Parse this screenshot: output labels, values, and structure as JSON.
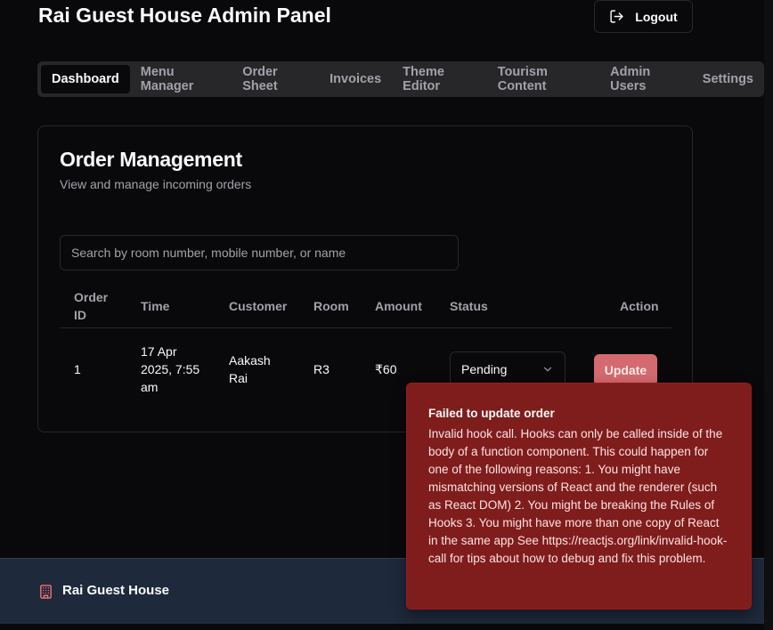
{
  "header": {
    "title": "Rai Guest House Admin Panel",
    "logout_label": "Logout"
  },
  "nav": {
    "tabs": [
      {
        "label": "Dashboard",
        "active": true
      },
      {
        "label": "Menu Manager",
        "active": false
      },
      {
        "label": "Order Sheet",
        "active": false
      },
      {
        "label": "Invoices",
        "active": false
      },
      {
        "label": "Theme Editor",
        "active": false
      },
      {
        "label": "Tourism Content",
        "active": false
      },
      {
        "label": "Admin Users",
        "active": false
      },
      {
        "label": "Settings",
        "active": false
      }
    ]
  },
  "card": {
    "title": "Order Management",
    "subtitle": "View and manage incoming orders",
    "search_placeholder": "Search by room number, mobile number, or name"
  },
  "table": {
    "headers": {
      "order_id": "Order ID",
      "time": "Time",
      "customer": "Customer",
      "room": "Room",
      "amount": "Amount",
      "status": "Status",
      "action": "Action"
    },
    "rows": [
      {
        "order_id": "1",
        "time": "17 Apr 2025, 7:55 am",
        "customer": "Aakash Rai",
        "room": "R3",
        "amount": "₹60",
        "status": "Pending",
        "action_label": "Update"
      }
    ]
  },
  "footer": {
    "name": "Rai Guest House",
    "icon": "building-icon"
  },
  "toast": {
    "title": "Failed to update order",
    "message": "Invalid hook call. Hooks can only be called inside of the body of a function component. This could happen for one of the following reasons: 1. You might have mismatching versions of React and the renderer (such as React DOM) 2. You might be breaking the Rules of Hooks 3. You might have more than one copy of React in the same app See https://reactjs.org/link/invalid-hook-call for tips about how to debug and fix this problem."
  },
  "colors": {
    "background": "#09090b",
    "border": "#27272a",
    "update_button": "#d46a6f",
    "toast_background": "#7f1d1d",
    "footer_background": "#1e293b",
    "footer_icon": "#f87171"
  }
}
